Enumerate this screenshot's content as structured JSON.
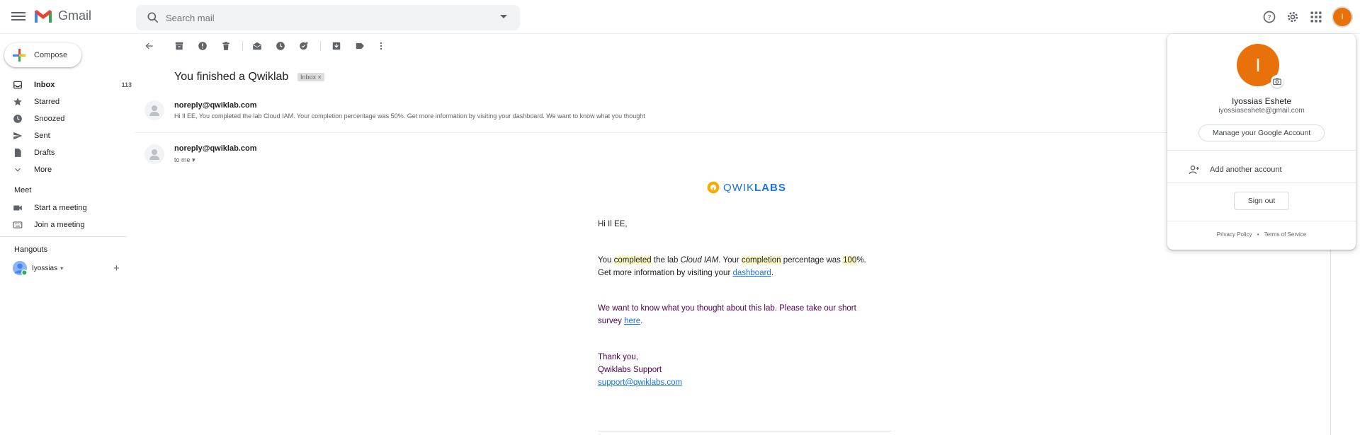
{
  "app": {
    "name": "Gmail"
  },
  "search": {
    "placeholder": "Search mail"
  },
  "compose": {
    "label": "Compose"
  },
  "sidebar": {
    "items": [
      {
        "label": "Inbox",
        "count": "113"
      },
      {
        "label": "Starred"
      },
      {
        "label": "Snoozed"
      },
      {
        "label": "Sent"
      },
      {
        "label": "Drafts"
      },
      {
        "label": "More"
      }
    ],
    "meet": {
      "title": "Meet",
      "items": [
        "Start a meeting",
        "Join a meeting"
      ]
    },
    "hangouts": {
      "title": "Hangouts",
      "user": "Iyossias"
    }
  },
  "message": {
    "subject": "You finished a Qwiklab",
    "label_chip": "Inbox",
    "first": {
      "sender": "noreply@qwiklab.com",
      "snippet": "Hi Il EE, You completed the lab Cloud IAM. Your completion percentage was 50%. Get more information by visiting your dashboard. We want to know what you thought"
    },
    "second": {
      "sender": "noreply@qwiklab.com",
      "to": "to me"
    },
    "logo": {
      "left": "QWIK",
      "right": "LABS"
    },
    "body": {
      "greeting": "Hi Il EE,",
      "p1_a": "You ",
      "p1_completed": "completed",
      "p1_b": " the lab ",
      "p1_lab": "Cloud IAM",
      "p1_c": ". Your ",
      "p1_completion": "completion",
      "p1_d": " percentage was ",
      "p1_pct": "100",
      "p1_e": "%.",
      "p2_a": "Get more information by visiting your ",
      "p2_link": "dashboard",
      "p2_b": ".",
      "p3_a": "We want to know what you thought about this lab. Please take our short",
      "p3_b": "survey ",
      "p3_link": "here",
      "p3_c": ".",
      "thanks": "Thank you,",
      "team": "Qwiklabs Support",
      "support_email": "support@qwiklabs.com"
    }
  },
  "account": {
    "initial": "I",
    "name": "Iyossias Eshete",
    "email": "iyossiaseshete@gmail.com",
    "manage": "Manage your Google Account",
    "add": "Add another account",
    "signout": "Sign out",
    "privacy": "Privacy Policy",
    "sep": "•",
    "terms": "Terms of Service"
  },
  "colors": {
    "accent": "#e8710a",
    "link": "#1a73e8",
    "purple_text": "#500050"
  }
}
